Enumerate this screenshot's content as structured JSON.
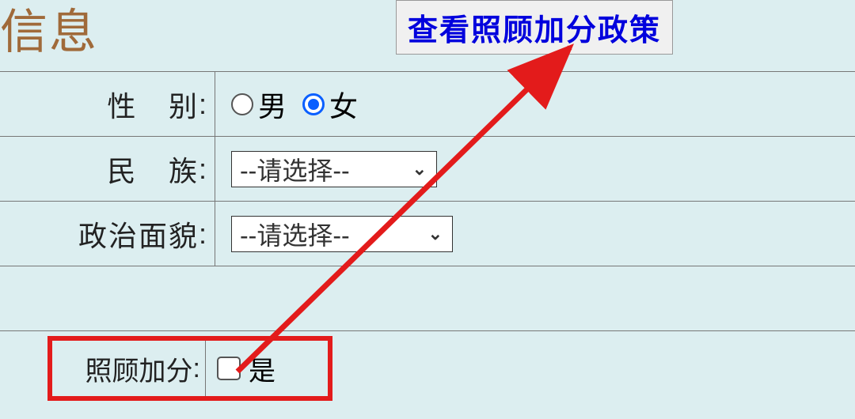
{
  "page_title": "信息",
  "policy_button_label": "查看照顾加分政策",
  "gender": {
    "label_char1": "性",
    "label_char2": "别",
    "colon": ":",
    "option_male": "男",
    "option_female": "女",
    "selected": "female"
  },
  "ethnicity": {
    "label_char1": "民",
    "label_char2": "族",
    "colon": ":",
    "placeholder": "--请选择--"
  },
  "political_status": {
    "label": "政治面貌",
    "colon": ":",
    "placeholder": "--请选择--"
  },
  "bonus_points": {
    "label": "照顾加分",
    "colon": ":",
    "option_yes": "是",
    "checked": false
  }
}
